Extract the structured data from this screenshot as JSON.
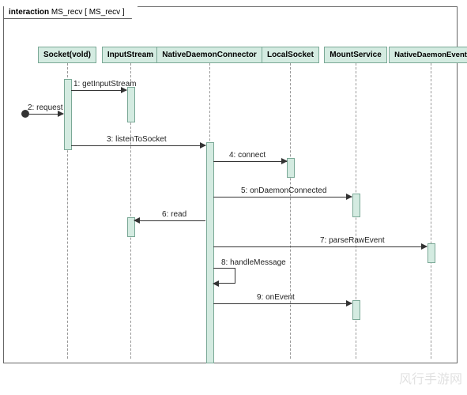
{
  "frame": {
    "keyword": "interaction",
    "name": "MS_recv",
    "params": "[ MS_recv ]"
  },
  "lifelines": [
    {
      "id": "socket",
      "label": "Socket(vold)"
    },
    {
      "id": "input",
      "label": "InputStream"
    },
    {
      "id": "connector",
      "label": "NativeDaemonConnector"
    },
    {
      "id": "localsocket",
      "label": "LocalSocket"
    },
    {
      "id": "mountservice",
      "label": "MountService"
    },
    {
      "id": "event",
      "label": "NativeDaemonEvent"
    }
  ],
  "messages": [
    {
      "n": 1,
      "label": "1: getInputStream",
      "from": "socket",
      "to": "input"
    },
    {
      "n": 2,
      "label": "2: request",
      "from": "found",
      "to": "socket"
    },
    {
      "n": 3,
      "label": "3: listenToSocket",
      "from": "socket",
      "to": "connector"
    },
    {
      "n": 4,
      "label": "4: connect",
      "from": "connector",
      "to": "localsocket"
    },
    {
      "n": 5,
      "label": "5: onDaemonConnected",
      "from": "connector",
      "to": "mountservice"
    },
    {
      "n": 6,
      "label": "6: read",
      "from": "connector",
      "to": "input"
    },
    {
      "n": 7,
      "label": "7: parseRawEvent",
      "from": "connector",
      "to": "event"
    },
    {
      "n": 8,
      "label": "8: handleMessage",
      "from": "connector",
      "to": "connector"
    },
    {
      "n": 9,
      "label": "9: onEvent",
      "from": "connector",
      "to": "mountservice"
    }
  ],
  "watermark": "风行手游网",
  "chart_data": {
    "type": "sequence-diagram",
    "title": "interaction MS_recv [ MS_recv ]",
    "participants": [
      "Socket(vold)",
      "InputStream",
      "NativeDaemonConnector",
      "LocalSocket",
      "MountService",
      "NativeDaemonEvent"
    ],
    "interactions": [
      {
        "seq": 1,
        "from": "Socket(vold)",
        "to": "InputStream",
        "message": "getInputStream"
      },
      {
        "seq": 2,
        "from": "(found)",
        "to": "Socket(vold)",
        "message": "request"
      },
      {
        "seq": 3,
        "from": "Socket(vold)",
        "to": "NativeDaemonConnector",
        "message": "listenToSocket"
      },
      {
        "seq": 4,
        "from": "NativeDaemonConnector",
        "to": "LocalSocket",
        "message": "connect"
      },
      {
        "seq": 5,
        "from": "NativeDaemonConnector",
        "to": "MountService",
        "message": "onDaemonConnected"
      },
      {
        "seq": 6,
        "from": "NativeDaemonConnector",
        "to": "InputStream",
        "message": "read"
      },
      {
        "seq": 7,
        "from": "NativeDaemonConnector",
        "to": "NativeDaemonEvent",
        "message": "parseRawEvent"
      },
      {
        "seq": 8,
        "from": "NativeDaemonConnector",
        "to": "NativeDaemonConnector",
        "message": "handleMessage"
      },
      {
        "seq": 9,
        "from": "NativeDaemonConnector",
        "to": "MountService",
        "message": "onEvent"
      }
    ]
  }
}
